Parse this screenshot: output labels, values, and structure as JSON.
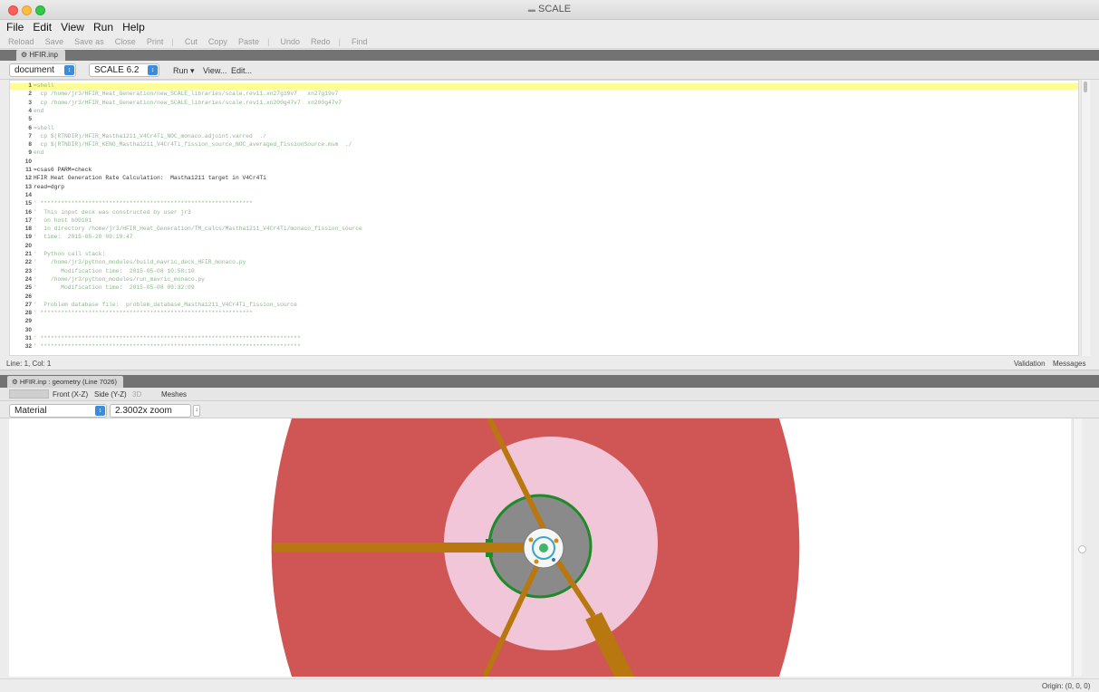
{
  "window": {
    "title": "SCALE",
    "title_icon": "scale-app-icon"
  },
  "menu": [
    "File",
    "Edit",
    "View",
    "Run",
    "Help"
  ],
  "toolbar": [
    "Reload",
    "Save",
    "Save as",
    "Close",
    "Print",
    "Cut",
    "Copy",
    "Paste",
    "Undo",
    "Redo",
    "Find"
  ],
  "editor": {
    "tab_label": "HFIR.inp",
    "mode_select": "document",
    "version_select": "SCALE 6.2",
    "run_label": "Run",
    "view_label": "View...",
    "edit_label": "Edit...",
    "lines": [
      {
        "n": "1",
        "t": "=shell",
        "kw": false,
        "hl": true
      },
      {
        "n": "2",
        "t": "  cp /home/jr3/HFIR_Heat_Generation/new_SCALE_libraries/scale.rev11.xn27g19v7   xn27g19v7",
        "kw": false
      },
      {
        "n": "3",
        "t": "  cp /home/jr3/HFIR_Heat_Generation/new_SCALE_libraries/scale.rev11.xn200g47v7  xn200g47v7",
        "kw": false
      },
      {
        "n": "4",
        "t": "end",
        "kw": false
      },
      {
        "n": "5",
        "t": "",
        "kw": false
      },
      {
        "n": "6",
        "t": "=shell",
        "kw": false
      },
      {
        "n": "7",
        "t": "  cp $(RTNDIR)/HFIR_Mastha1211_V4Cr4Ti_NOC_monaco.adjoint.varred  ./",
        "kw": false
      },
      {
        "n": "8",
        "t": "  cp $(RTNDIR)/HFIR_KENO_Mastha1211_V4Cr4Ti_fission_source_NOC_averaged_fissionSource.msm  ./",
        "kw": false
      },
      {
        "n": "9",
        "t": "end",
        "kw": false
      },
      {
        "n": "10",
        "t": "",
        "kw": false
      },
      {
        "n": "11",
        "t": "=csas6 PARM=check",
        "kw": true
      },
      {
        "n": "12",
        "t": "HFIR Heat Generation Rate Calculation:  Mastha1211 target in V4Cr4Ti",
        "kw": true
      },
      {
        "n": "13",
        "t": "read=dgrp",
        "kw": true
      },
      {
        "n": "14",
        "t": "",
        "kw": false
      },
      {
        "n": "15",
        "t": "' **************************************************************",
        "kw": false
      },
      {
        "n": "16",
        "t": "'  This input deck was constructed by user jr3",
        "kw": false
      },
      {
        "n": "17",
        "t": "'  on host b00101",
        "kw": false
      },
      {
        "n": "18",
        "t": "'  in directory /home/jr3/HFIR_Heat_Generation/TM_calcs/Mastha1211_V4Cr4Ti/monaco_fission_source",
        "kw": false
      },
      {
        "n": "19",
        "t": "'  time:  2015-05-20 09:19:47",
        "kw": false
      },
      {
        "n": "20",
        "t": "",
        "kw": false
      },
      {
        "n": "21",
        "t": "'  Python call stack:",
        "kw": false
      },
      {
        "n": "22",
        "t": "'    /home/jr3/python_modules/build_mavric_deck_HFIR_monaco.py",
        "kw": false
      },
      {
        "n": "23",
        "t": "'       Modification time:  2015-05-08 10:58:10",
        "kw": false
      },
      {
        "n": "24",
        "t": "'    /home/jr3/python_modules/run_mavric_monaco.py",
        "kw": false
      },
      {
        "n": "25",
        "t": "'       Modification time:  2015-05-08 09:32:09",
        "kw": false
      },
      {
        "n": "26",
        "t": "",
        "kw": false
      },
      {
        "n": "27",
        "t": "'  Problem database file:  problem_database_Mastha1211_V4Cr4Ti_fission_source",
        "kw": false
      },
      {
        "n": "28",
        "t": "' **************************************************************",
        "kw": false
      },
      {
        "n": "29",
        "t": "",
        "kw": false
      },
      {
        "n": "30",
        "t": "",
        "kw": false
      },
      {
        "n": "31",
        "t": "' ****************************************************************************",
        "kw": false
      },
      {
        "n": "32",
        "t": "' ****************************************************************************",
        "kw": false
      }
    ],
    "status_cursor": "Line: 1, Col: 1",
    "status_validation": "Validation",
    "status_messages": "Messages"
  },
  "geometry": {
    "tab_label": "HFIR.inp : geometry (Line 7026)",
    "view_tabs": [
      "Front (X-Z)",
      "Side (Y-Z)",
      "3D",
      "Meshes"
    ],
    "color_by": "Material",
    "zoom": "2.3002x zoom",
    "status_origin": "Origin: (0, 0, 0)"
  },
  "colors": {
    "outer_region": "#cf5655",
    "pink_region": "#f1c6d9",
    "gray_region": "#8a8a8a",
    "green_ring": "#1f8a2a",
    "support_arm": "#b9770f",
    "highlight_line": "#fdfd96"
  }
}
